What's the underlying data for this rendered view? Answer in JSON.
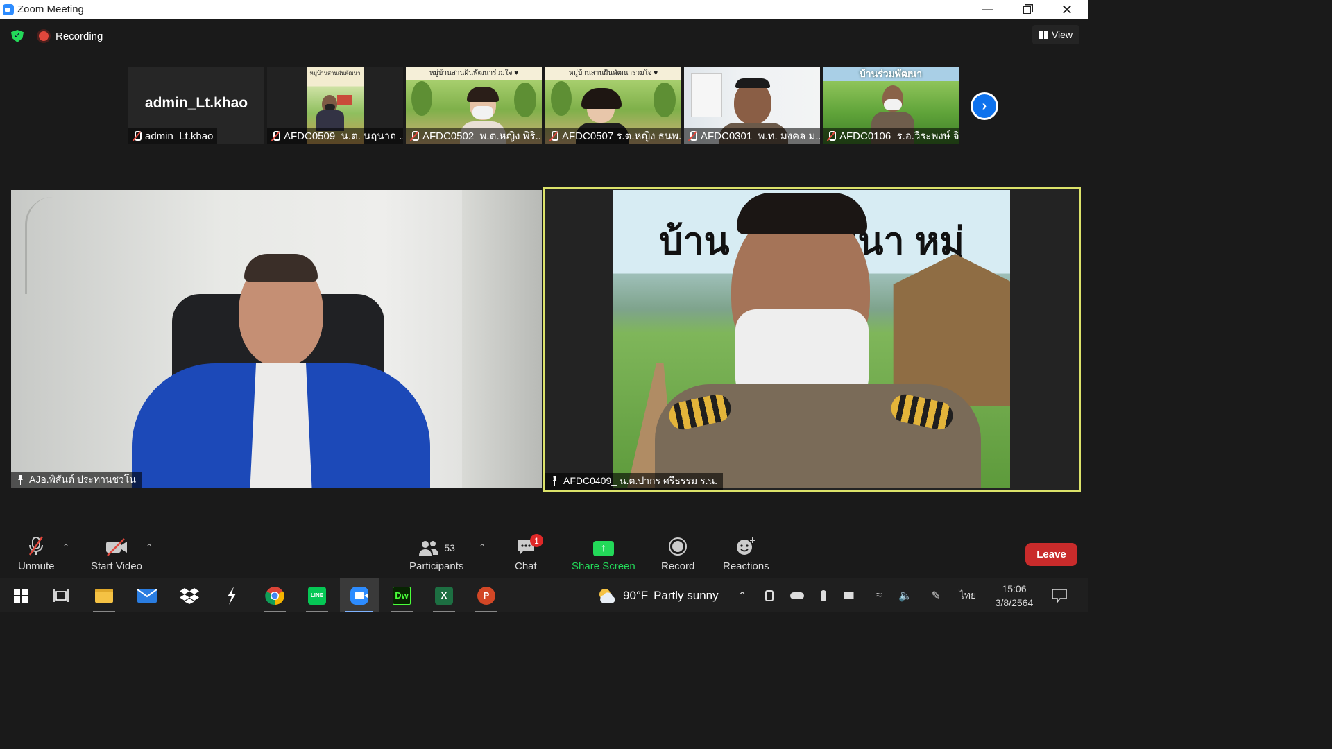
{
  "window": {
    "title": "Zoom Meeting",
    "icon": "zoom-logo-icon",
    "controls": [
      "minimize-icon",
      "restore-icon",
      "close-icon"
    ]
  },
  "status": {
    "recording_label": "Recording",
    "view_label": "View"
  },
  "thumbnails": [
    {
      "name": "admin_Lt.khao",
      "display_text": "admin_Lt.khao",
      "muted": true,
      "video": false
    },
    {
      "name": "AFDC0509_น.ต. นฤนาถ ...",
      "banner": "หมู่บ้านสานฝันพัฒนา",
      "muted": true,
      "video": true
    },
    {
      "name": "AFDC0502_พ.ต.หญิง พิริ...",
      "banner": "หมู่บ้านสานฝันพัฒนาร่วมใจ ♥",
      "muted": true,
      "video": true
    },
    {
      "name": "AFDC0507 ร.ต.หญิง ธนพ...",
      "banner": "หมู่บ้านสานฝันพัฒนาร่วมใจ ♥",
      "muted": true,
      "video": true
    },
    {
      "name": "AFDC0301_พ.ท. มงคล ม...",
      "muted": true,
      "video": true
    },
    {
      "name": "AFDC0106_ร.อ.วีระพงษ์ จิ...",
      "banner": "บ้านร่วมพัฒนา",
      "muted": true,
      "video": true
    }
  ],
  "main_videos": {
    "left": {
      "name": "AJอ.พิสันต์ ประทานชวโน",
      "pinned": true
    },
    "right": {
      "name": "AFDC0409_ น.ต.ปากร ศรีธรรม ร.น.",
      "pinned": true,
      "active_speaker": true,
      "background_text": "บ้าน      ร่วมนา หมู่"
    }
  },
  "toolbar": {
    "unmute": "Unmute",
    "start_video": "Start Video",
    "participants": "Participants",
    "participant_count": "53",
    "chat": "Chat",
    "chat_badge": "1",
    "share_screen": "Share Screen",
    "record": "Record",
    "reactions": "Reactions",
    "leave": "Leave",
    "share_color": "#23d959",
    "leave_color": "#c92b2b"
  },
  "taskbar": {
    "apps": [
      "windows-start-icon",
      "task-view-icon",
      "file-explorer-icon",
      "mail-icon",
      "dropbox-icon",
      "app-s-icon",
      "chrome-icon",
      "line-icon",
      "zoom-icon",
      "dreamweaver-icon",
      "excel-icon",
      "powerpoint-icon"
    ],
    "dw_label": "Dw",
    "excel_label": "X",
    "ppt_label": "P",
    "line_label": "LINE",
    "weather_temp": "90°F",
    "weather_desc": "Partly sunny",
    "language": "ไทย",
    "time": "15:06",
    "date": "3/8/2564"
  }
}
